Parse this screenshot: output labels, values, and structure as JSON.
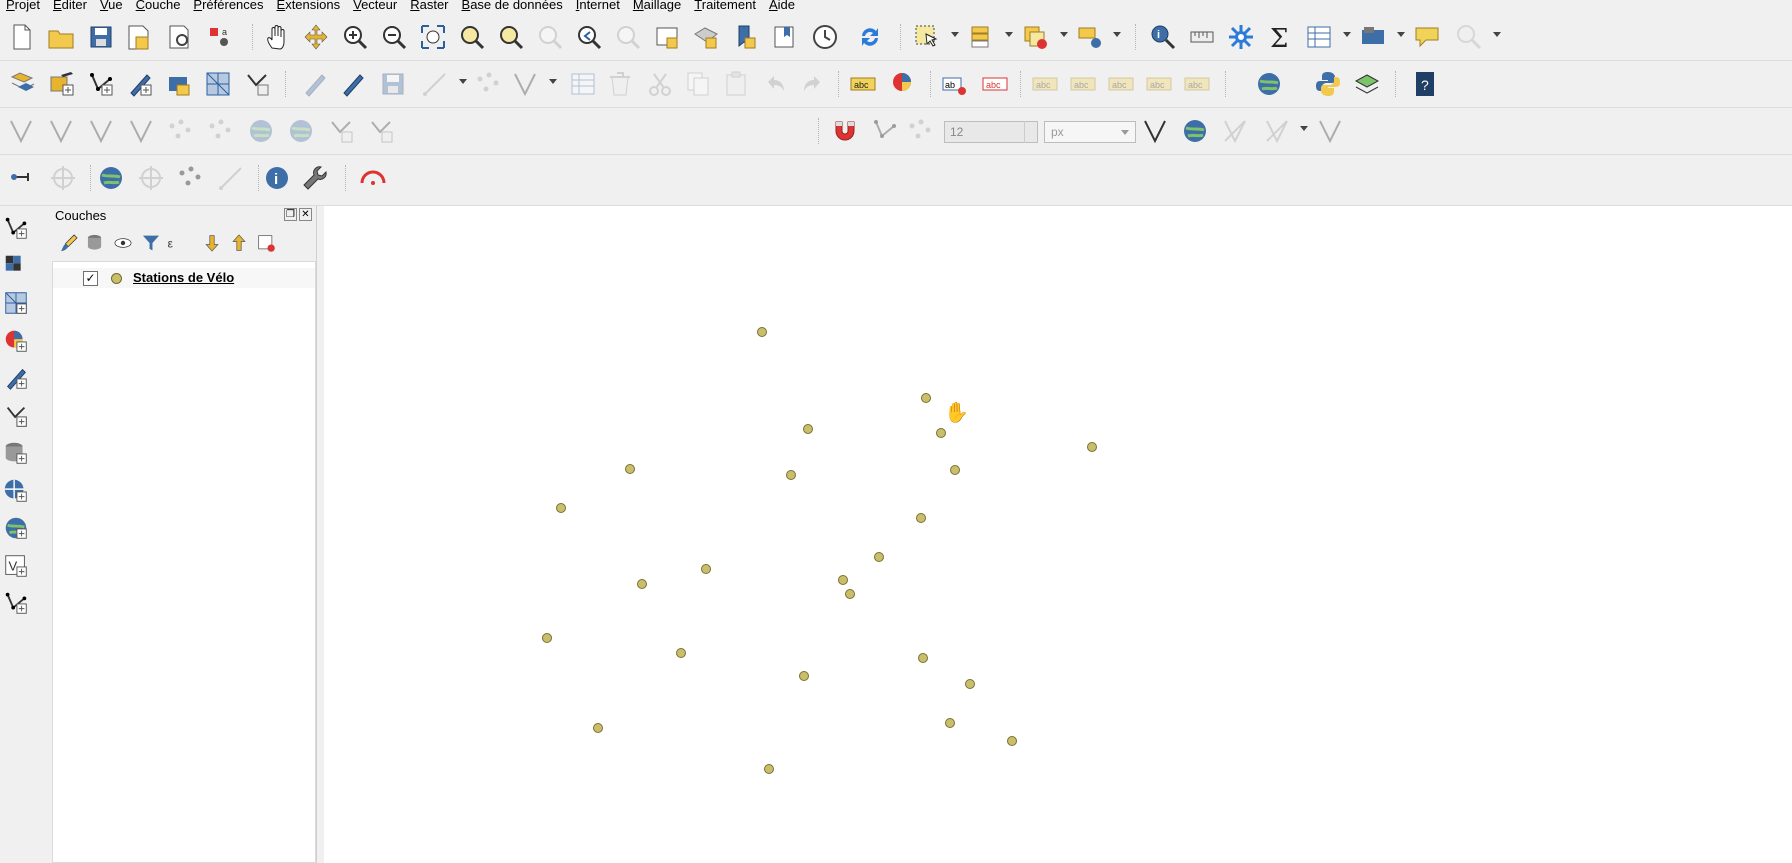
{
  "menu": [
    {
      "id": "projet",
      "label": "Projet"
    },
    {
      "id": "editer",
      "label": "Editer"
    },
    {
      "id": "vue",
      "label": "Vue"
    },
    {
      "id": "couche",
      "label": "Couche"
    },
    {
      "id": "preferences",
      "label": "Préférences"
    },
    {
      "id": "extensions",
      "label": "Extensions"
    },
    {
      "id": "vecteur",
      "label": "Vecteur"
    },
    {
      "id": "raster",
      "label": "Raster"
    },
    {
      "id": "base",
      "label": "Base de données"
    },
    {
      "id": "internet",
      "label": "Internet"
    },
    {
      "id": "maillage",
      "label": "Maillage"
    },
    {
      "id": "traitement",
      "label": "Traitement"
    },
    {
      "id": "aide",
      "label": "Aide"
    }
  ],
  "snapping": {
    "size": "12",
    "unit": "px"
  },
  "layers_panel": {
    "title": "Couches",
    "layers": [
      {
        "name": "Stations de Vélo",
        "checked": "✓",
        "color": "#c8bf6a"
      }
    ]
  },
  "map": {
    "stations": [
      {
        "lon": 3.8769,
        "lat": 43.6253
      },
      {
        "lon": 3.8715,
        "lat": 43.617
      },
      {
        "lon": 3.8781,
        "lat": 43.6166
      },
      {
        "lon": 3.8848,
        "lat": 43.6169
      },
      {
        "lon": 3.8788,
        "lat": 43.6194
      },
      {
        "lon": 3.8836,
        "lat": 43.6213
      },
      {
        "lon": 3.8842,
        "lat": 43.6192
      },
      {
        "lon": 3.8834,
        "lat": 43.614
      },
      {
        "lon": 3.8817,
        "lat": 43.6116
      },
      {
        "lon": 3.8802,
        "lat": 43.6102
      },
      {
        "lon": 3.8746,
        "lat": 43.6109
      },
      {
        "lon": 3.872,
        "lat": 43.61
      },
      {
        "lon": 3.8681,
        "lat": 43.6067
      },
      {
        "lon": 3.8687,
        "lat": 43.6146
      },
      {
        "lon": 3.8736,
        "lat": 43.6058
      },
      {
        "lon": 3.8786,
        "lat": 43.6044
      },
      {
        "lon": 3.8805,
        "lat": 43.6094
      },
      {
        "lon": 3.8854,
        "lat": 43.6039
      },
      {
        "lon": 3.8835,
        "lat": 43.6055
      },
      {
        "lon": 3.8846,
        "lat": 43.6015
      },
      {
        "lon": 3.8702,
        "lat": 43.6012
      },
      {
        "lon": 3.8772,
        "lat": 43.5987
      },
      {
        "lon": 3.8871,
        "lat": 43.6004
      },
      {
        "lon": 3.8904,
        "lat": 43.6183
      }
    ]
  }
}
